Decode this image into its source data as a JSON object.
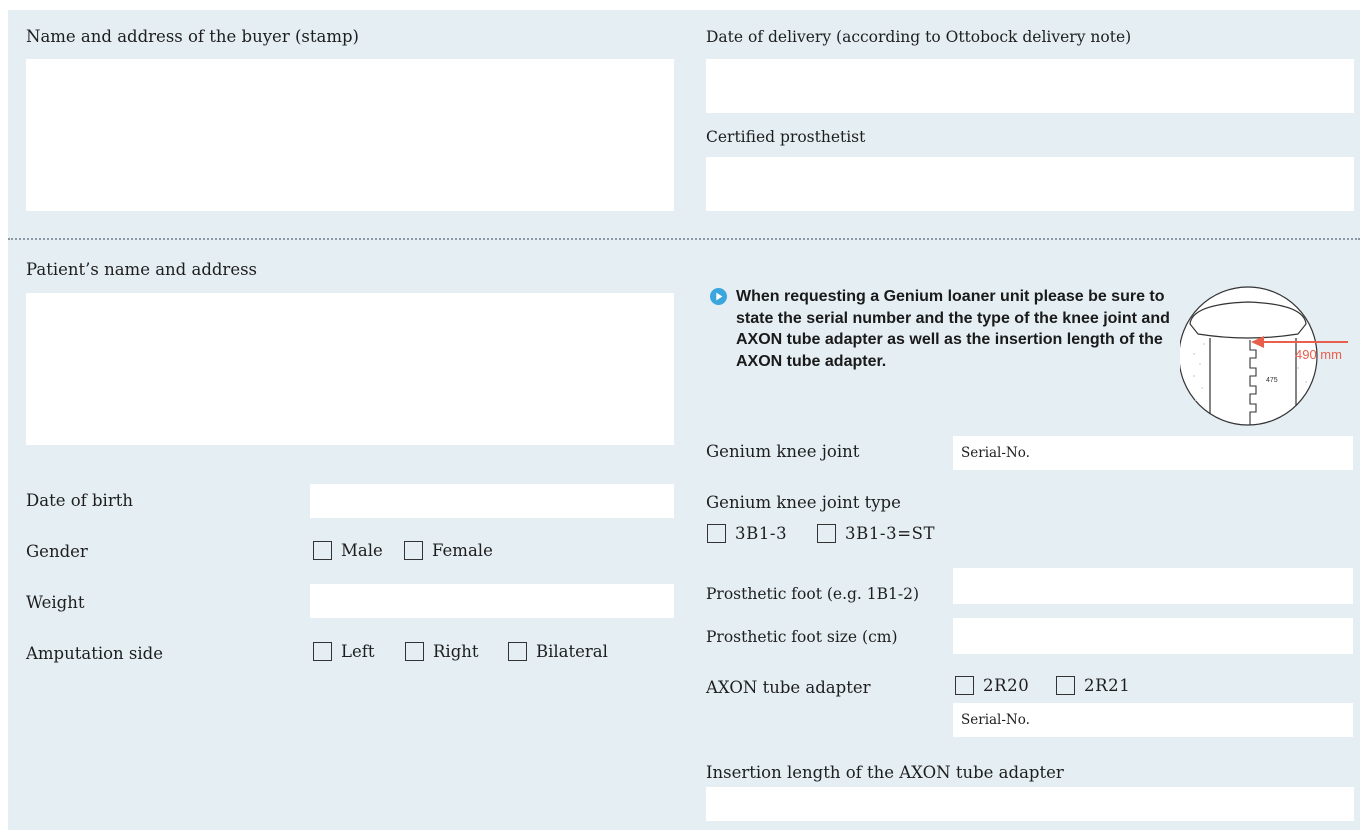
{
  "buyer": {
    "label": "Name and address of the buyer (stamp)"
  },
  "delivery": {
    "label": "Date of delivery (according to Ottobock delivery note)"
  },
  "prosthetist": {
    "label": "Certified prosthetist"
  },
  "patient": {
    "label": "Patient’s name and address",
    "date_of_birth_label": "Date of birth",
    "gender_label": "Gender",
    "gender_options": [
      "Male",
      "Female"
    ],
    "weight_label": "Weight",
    "amputation_label": "Amputation side",
    "amputation_options": [
      "Left",
      "Right",
      "Bilateral"
    ]
  },
  "notice": {
    "text": "When requesting a Genium loaner unit please be sure to state the serial number and the type of the knee joint and AXON tube adapter as well as the insertion length of the AXON tube adapter.",
    "diagram_measure": "490 mm",
    "diagram_tick": "475",
    "accent_color": "#e8604c",
    "icon": "play-circle-icon"
  },
  "knee": {
    "label": "Genium knee joint",
    "serial_placeholder": "Serial-No.",
    "type_label": "Genium knee joint type",
    "type_options": [
      "3B1-3",
      "3B1-3=ST"
    ]
  },
  "foot": {
    "label": "Prosthetic foot (e.g. 1B1-2)",
    "size_label": "Prosthetic foot size (cm)"
  },
  "axon": {
    "label": "AXON tube adapter",
    "options": [
      "2R20",
      "2R21"
    ],
    "serial_placeholder": "Serial-No.",
    "insertion_label": "Insertion length of the AXON tube adapter"
  }
}
